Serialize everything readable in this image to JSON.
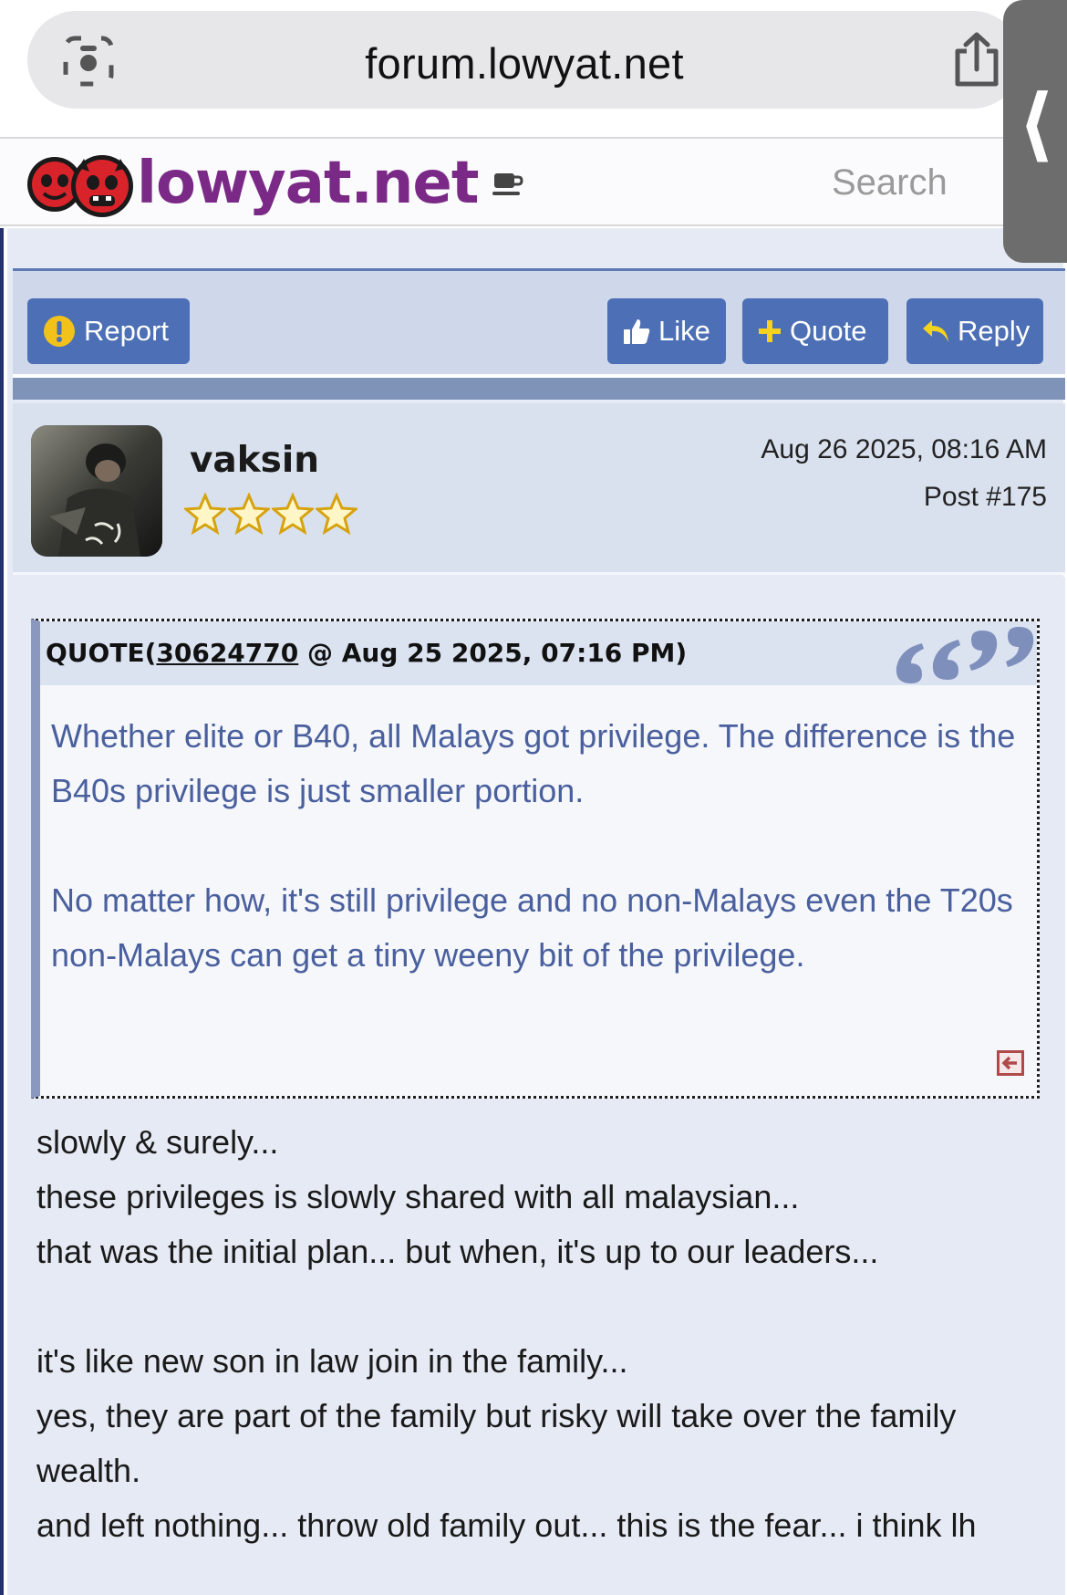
{
  "browser": {
    "url": "forum.lowyat.net"
  },
  "site": {
    "logo_text": "lowyat.net",
    "search_placeholder": "Search"
  },
  "actions": {
    "report": "Report",
    "like": "Like",
    "quote": "Quote",
    "reply": "Reply"
  },
  "post": {
    "username": "vaksin",
    "star_count": 4,
    "date": "Aug 26 2025, 08:16 AM",
    "post_number": "Post #175",
    "quote": {
      "prefix": "QUOTE(",
      "post_id": "30624770",
      "suffix": " @ Aug 25 2025, 07:16 PM)",
      "paragraphs": [
        "Whether elite or B40, all Malays got privilege. The difference is the B40s privilege is just smaller portion.",
        "No matter how, it's still privilege and no non-Malays even the T20s non-Malays can get a tiny weeny bit of the privilege."
      ]
    },
    "body_lines": [
      "slowly & surely...",
      "these privileges is slowly shared with all malaysian...",
      "that was the initial plan... but when, it's up to our leaders...",
      "",
      "it's like new son in law join in the family...",
      "yes, they are part of the family but risky will take over the family wealth.",
      "and left nothing... throw old family out... this is the fear... i think lh"
    ]
  },
  "colors": {
    "accent_button": "#4c6fb5",
    "quote_text": "#4a5f9d",
    "logo": "#7a2a86"
  }
}
